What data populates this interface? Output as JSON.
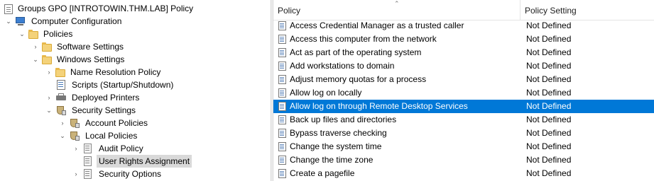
{
  "tree": {
    "nodes": [
      {
        "label": "Groups GPO [INTROTOWIN.THM.LAB] Policy",
        "icon": "policy-document-icon"
      },
      {
        "label": "Computer Configuration",
        "icon": "computer-icon",
        "expander": "expanded"
      },
      {
        "label": "Policies",
        "icon": "folder-icon",
        "expander": "expanded"
      },
      {
        "label": "Software Settings",
        "icon": "folder-icon",
        "expander": "collapsed"
      },
      {
        "label": "Windows Settings",
        "icon": "folder-icon",
        "expander": "expanded"
      },
      {
        "label": "Name Resolution Policy",
        "icon": "folder-icon",
        "expander": "collapsed"
      },
      {
        "label": "Scripts (Startup/Shutdown)",
        "icon": "script-icon",
        "expander": "none"
      },
      {
        "label": "Deployed Printers",
        "icon": "printer-icon",
        "expander": "collapsed"
      },
      {
        "label": "Security Settings",
        "icon": "security-shield-icon",
        "expander": "expanded"
      },
      {
        "label": "Account Policies",
        "icon": "security-shield-icon",
        "expander": "collapsed"
      },
      {
        "label": "Local Policies",
        "icon": "security-shield-icon",
        "expander": "expanded"
      },
      {
        "label": "Audit Policy",
        "icon": "policy-icon",
        "expander": "collapsed"
      },
      {
        "label": "User Rights Assignment",
        "icon": "policy-icon",
        "expander": "none",
        "selected": true
      },
      {
        "label": "Security Options",
        "icon": "policy-icon",
        "expander": "collapsed"
      }
    ]
  },
  "list": {
    "columns": {
      "policy": "Policy",
      "setting": "Policy Setting"
    },
    "rows": [
      {
        "policy": "Access Credential Manager as a trusted caller",
        "setting": "Not Defined"
      },
      {
        "policy": "Access this computer from the network",
        "setting": "Not Defined"
      },
      {
        "policy": "Act as part of the operating system",
        "setting": "Not Defined"
      },
      {
        "policy": "Add workstations to domain",
        "setting": "Not Defined"
      },
      {
        "policy": "Adjust memory quotas for a process",
        "setting": "Not Defined"
      },
      {
        "policy": "Allow log on locally",
        "setting": "Not Defined"
      },
      {
        "policy": "Allow log on through Remote Desktop Services",
        "setting": "Not Defined",
        "selected": true
      },
      {
        "policy": "Back up files and directories",
        "setting": "Not Defined"
      },
      {
        "policy": "Bypass traverse checking",
        "setting": "Not Defined"
      },
      {
        "policy": "Change the system time",
        "setting": "Not Defined"
      },
      {
        "policy": "Change the time zone",
        "setting": "Not Defined"
      },
      {
        "policy": "Create a pagefile",
        "setting": "Not Defined"
      }
    ]
  },
  "colors": {
    "selection": "#0078d7",
    "tree_selection": "#d9d9d9"
  }
}
